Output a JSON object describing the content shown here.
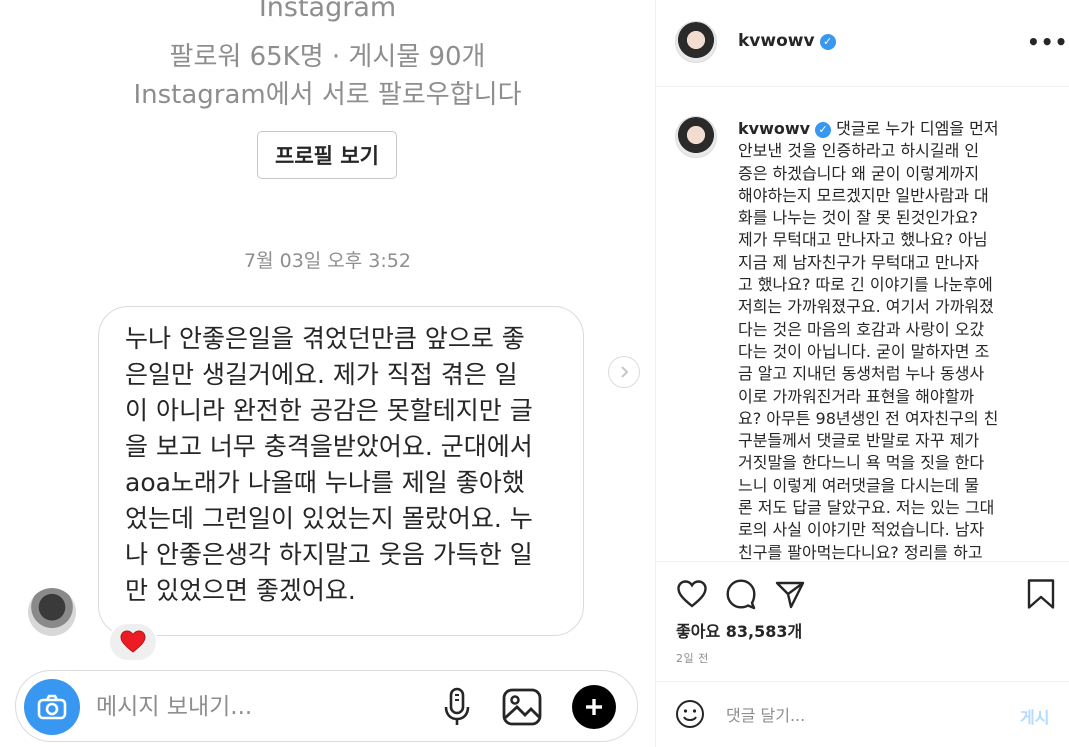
{
  "dm": {
    "app_name": "Instagram",
    "stats": "팔로워 65K명 · 게시물 90개",
    "follow_note": "Instagram에서 서로 팔로우합니다",
    "view_profile_label": "프로필 보기",
    "timestamp": "7월 03일 오후 3:52",
    "message_lines": [
      "누나 안좋은일을 겪었던만큼 앞으로 좋",
      "은일만 생길거에요. 제가 직접 겪은 일",
      "이 아니라 완전한 공감은 못할테지만 글",
      "을 보고 너무 충격을받았어요. 군대에서",
      "aoa노래가 나올때 누나를 제일 좋아했",
      "었는데 그런일이 있었는지 몰랐어요. 누",
      "나 안좋은생각 하지말고 웃음 가득한 일",
      "만 있었으면 좋겠어요."
    ],
    "reaction": "❤️",
    "composer_placeholder": "메시지 보내기...",
    "icons": [
      "camera-icon",
      "microphone-icon",
      "gallery-icon",
      "plus-icon",
      "chevron-right-icon"
    ]
  },
  "post": {
    "username": "kvwowv",
    "verified": true,
    "more_label": "•••",
    "caption_lines": [
      "댓글로 누가 디엠을 먼저",
      "안보낸 것을 인증하라고 하시길래 인",
      "증은 하겠습니다 왜 굳이 이렇게까지",
      "해야하는지 모르겠지만 일반사람과 대",
      "화를 나누는 것이 잘 못 된것인가요?",
      "제가 무턱대고 만나자고 했나요? 아님",
      "지금 제 남자친구가 무턱대고 만나자",
      "고 했나요? 따로 긴 이야기를 나눈후에",
      "저희는 가까워졌구요. 여기서 가까워졌",
      "다는 것은 마음의 호감과 사랑이 오갔",
      "다는 것이 아닙니다. 굳이 말하자면 조",
      "금 알고 지내던 동생처럼 누나 동생사",
      "이로 가까워진거라 표현을 해야할까",
      "요? 아무튼 98년생인 전 여자친구의 친",
      "구분들께서 댓글로 반말로 자꾸 제가",
      "거짓말을 한다느니 욕 먹을 짓을 한다",
      "느니 이렇게 여러댓글을 다시는데 물",
      "론 저도 답글 달았구요. 저는 있는 그대",
      "로의 사실 이야기만 적었습니다. 남자",
      "친구를 팔아먹는다니요? 정리를 하고"
    ],
    "likes": "좋아요 83,583개",
    "date": "2일 전",
    "comment_placeholder": "댓글 달기...",
    "post_label": "게시",
    "icons": [
      "heart-icon",
      "comment-icon",
      "share-icon",
      "bookmark-icon",
      "emoji-icon",
      "verified-icon"
    ]
  },
  "colors": {
    "accent": "#3897f0",
    "post_disabled": "#b3dbff",
    "muted": "#8e8e8e",
    "border": "#dbdbdb"
  }
}
